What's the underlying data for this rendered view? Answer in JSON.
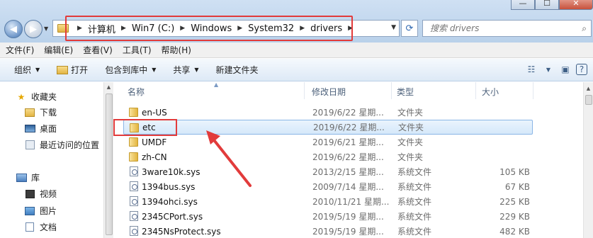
{
  "window": {
    "minimize_glyph": "—",
    "maximize_glyph": "☐",
    "close_glyph": "✕"
  },
  "address": {
    "crumbs": [
      "计算机",
      "Win7 (C:)",
      "Windows",
      "System32",
      "drivers"
    ]
  },
  "search": {
    "placeholder": "搜索 drivers"
  },
  "menubar": {
    "items": [
      "文件(F)",
      "编辑(E)",
      "查看(V)",
      "工具(T)",
      "帮助(H)"
    ]
  },
  "commandbar": {
    "organize": "组织",
    "open": "打开",
    "include_in_library": "包含到库中",
    "share": "共享",
    "new_folder": "新建文件夹"
  },
  "sidebar": {
    "items": [
      {
        "label": "收藏夹",
        "icon": "star-icon"
      },
      {
        "label": "下载",
        "icon": "downloads-folder-icon"
      },
      {
        "label": "桌面",
        "icon": "desktop-icon"
      },
      {
        "label": "最近访问的位置",
        "icon": "recent-places-icon"
      },
      {
        "label": "库",
        "icon": "library-icon"
      },
      {
        "label": "视频",
        "icon": "videos-icon"
      },
      {
        "label": "图片",
        "icon": "pictures-icon"
      },
      {
        "label": "文档",
        "icon": "documents-icon"
      }
    ]
  },
  "columns": {
    "name": "名称",
    "modified": "修改日期",
    "type": "类型",
    "size": "大小"
  },
  "files": [
    {
      "name": "en-US",
      "date": "2019/6/22 星期...",
      "type": "文件夹",
      "size": "",
      "kind": "folder"
    },
    {
      "name": "etc",
      "date": "2019/6/22 星期...",
      "type": "文件夹",
      "size": "",
      "kind": "folder"
    },
    {
      "name": "UMDF",
      "date": "2019/6/21 星期...",
      "type": "文件夹",
      "size": "",
      "kind": "folder"
    },
    {
      "name": "zh-CN",
      "date": "2019/6/22 星期...",
      "type": "文件夹",
      "size": "",
      "kind": "folder"
    },
    {
      "name": "3ware10k.sys",
      "date": "2013/2/15 星期...",
      "type": "系统文件",
      "size": "105 KB",
      "kind": "sys"
    },
    {
      "name": "1394bus.sys",
      "date": "2009/7/14 星期...",
      "type": "系统文件",
      "size": "67 KB",
      "kind": "sys"
    },
    {
      "name": "1394ohci.sys",
      "date": "2010/11/21 星期...",
      "type": "系统文件",
      "size": "225 KB",
      "kind": "sys"
    },
    {
      "name": "2345CPort.sys",
      "date": "2019/5/19 星期...",
      "type": "系统文件",
      "size": "229 KB",
      "kind": "sys"
    },
    {
      "name": "2345NsProtect.sys",
      "date": "2019/5/19 星期...",
      "type": "系统文件",
      "size": "482 KB",
      "kind": "sys"
    }
  ],
  "colors": {
    "highlight_red": "#e23b3b",
    "selection_blue": "#d5e8fa"
  }
}
